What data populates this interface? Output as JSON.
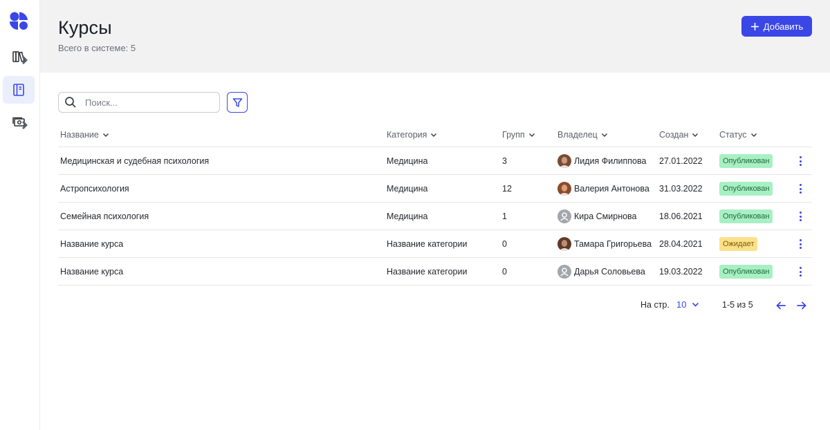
{
  "header": {
    "title": "Курсы",
    "subtitle": "Всего в системе: 5",
    "add_label": "Добавить"
  },
  "sidebar": {
    "items": [
      {
        "name": "library",
        "icon": "books-icon",
        "active": false
      },
      {
        "name": "courses",
        "icon": "notebook-icon",
        "active": true
      },
      {
        "name": "payments",
        "icon": "money-icon",
        "active": false
      }
    ]
  },
  "search": {
    "placeholder": "Поиск..."
  },
  "table": {
    "columns": [
      "Название",
      "Категория",
      "Групп",
      "Владелец",
      "Создан",
      "Статус"
    ],
    "rows": [
      {
        "name": "Медицинская и судебная психология",
        "category": "Медицина",
        "groups": "3",
        "owner": "Лидия Филиппова",
        "avatar": "photo",
        "created": "27.01.2022",
        "status": "Опубликован",
        "status_type": "published"
      },
      {
        "name": "Астропсихология",
        "category": "Медицина",
        "groups": "12",
        "owner": "Валерия Антонова",
        "avatar": "photo",
        "created": "31.03.2022",
        "status": "Опубликован",
        "status_type": "published"
      },
      {
        "name": "Семейная психология",
        "category": "Медицина",
        "groups": "1",
        "owner": "Кира Смирнова",
        "avatar": "placeholder",
        "created": "18.06.2021",
        "status": "Опубликован",
        "status_type": "published"
      },
      {
        "name": "Название курса",
        "category": "Название категории",
        "groups": "0",
        "owner": "Тамара Григорьева",
        "avatar": "photo",
        "created": "28.04.2021",
        "status": "Ожидает",
        "status_type": "pending"
      },
      {
        "name": "Название курса",
        "category": "Название категории",
        "groups": "0",
        "owner": "Дарья Соловьева",
        "avatar": "placeholder",
        "created": "19.03.2022",
        "status": "Опубликован",
        "status_type": "published"
      }
    ]
  },
  "pagination": {
    "per_page_label": "На стр.",
    "per_page_value": "10",
    "range_label": "1-5 из 5"
  },
  "colors": {
    "accent": "#3b46e6",
    "published_bg": "#a8efc4",
    "published_text": "#1f6b3d",
    "pending_bg": "#fde18a",
    "pending_text": "#7a5a00",
    "header_bg": "#f2f2f3"
  }
}
